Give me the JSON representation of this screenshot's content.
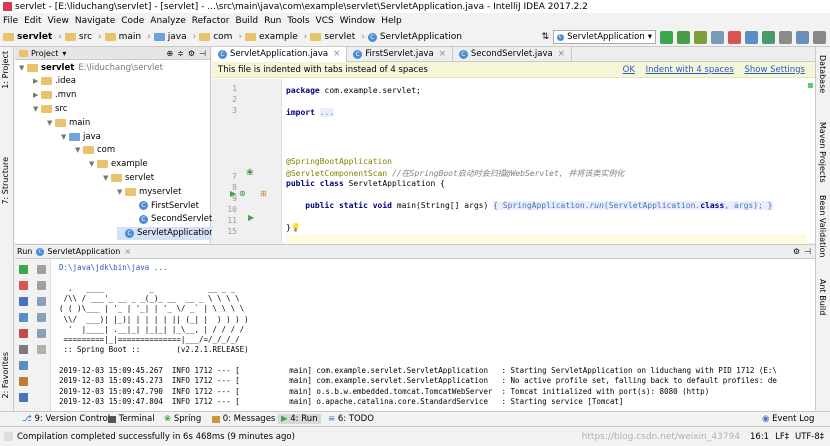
{
  "window": {
    "title": "servlet - [E:\\liduchang\\servlet] - [servlet] - ...\\src\\main\\java\\com\\example\\servlet\\ServletApplication.java - IntelliJ IDEA 2017.2.2"
  },
  "menu": [
    "File",
    "Edit",
    "View",
    "Navigate",
    "Code",
    "Analyze",
    "Refactor",
    "Build",
    "Run",
    "Tools",
    "VCS",
    "Window",
    "Help"
  ],
  "breadcrumb": [
    "servlet",
    "src",
    "main",
    "java",
    "com",
    "example",
    "servlet",
    "ServletApplication"
  ],
  "run_config": "ServletApplication",
  "left_tabs": {
    "project": "1: Project",
    "structure": "7: Structure",
    "favorites": "2: Favorites"
  },
  "right_tabs": {
    "database": "Database",
    "maven": "Maven Projects",
    "bean": "Bean Validation",
    "ant": "Ant Build"
  },
  "project": {
    "header": "Project",
    "tree": [
      {
        "label": "servlet",
        "extra": "E:\\liduchang\\servlet",
        "kind": "folder",
        "depth": 0,
        "open": true
      },
      {
        "label": ".idea",
        "kind": "folder",
        "depth": 1,
        "open": false
      },
      {
        "label": ".mvn",
        "kind": "folder",
        "depth": 1,
        "open": false
      },
      {
        "label": "src",
        "kind": "folder",
        "depth": 1,
        "open": true
      },
      {
        "label": "main",
        "kind": "folder",
        "depth": 2,
        "open": true
      },
      {
        "label": "java",
        "kind": "folder",
        "depth": 3,
        "open": true
      },
      {
        "label": "com",
        "kind": "folder",
        "depth": 4,
        "open": true
      },
      {
        "label": "example",
        "kind": "folder",
        "depth": 5,
        "open": true
      },
      {
        "label": "servlet",
        "kind": "folder",
        "depth": 6,
        "open": true
      },
      {
        "label": "myservlet",
        "kind": "folder",
        "depth": 7,
        "open": true
      },
      {
        "label": "FirstServlet",
        "kind": "class",
        "depth": 8
      },
      {
        "label": "SecondServlet",
        "kind": "class",
        "depth": 8
      },
      {
        "label": "ServletApplication",
        "kind": "class",
        "depth": 7,
        "selected": true
      }
    ]
  },
  "editor": {
    "tabs": [
      {
        "label": "ServletApplication.java",
        "active": true
      },
      {
        "label": "FirstServlet.java",
        "active": false
      },
      {
        "label": "SecondServlet.java",
        "active": false
      }
    ],
    "notice": "This file is indented with tabs instead of 4 spaces",
    "notice_actions": [
      "OK",
      "Indent with 4 spaces",
      "Show Settings"
    ],
    "line_numbers": [
      "1",
      "2",
      "3",
      "",
      "",
      "",
      "",
      "7",
      "8",
      "9",
      "10",
      "11",
      "",
      "",
      "15",
      "16"
    ],
    "lines": [
      {
        "n": "1",
        "text": "package com.example.servlet;"
      },
      {
        "n": "3",
        "text": "import ..."
      },
      {
        "n": "7",
        "text": "@SpringBootApplication"
      },
      {
        "n": "8",
        "text": "@ServletComponentScan //在SpringBoot启动时会扫描@WebServlet, 并将该类实例化"
      },
      {
        "n": "9",
        "text": "public class ServletApplication {"
      },
      {
        "n": "11",
        "text": "    public static void main(String[] args) { SpringApplication.run(ServletApplication.class, args); }"
      },
      {
        "n": "15",
        "text": "}"
      }
    ]
  },
  "run_panel": {
    "label": "Run",
    "config": "ServletApplication",
    "console": [
      "D:\\java\\jdk\\bin\\java ...",
      "",
      "  .   ____          _            __ _ _",
      " /\\\\ / ___'_ __ _ _(_)_ __  __ _ \\ \\ \\ \\",
      "( ( )\\___ | '_ | '_| | '_ \\/ _` | \\ \\ \\ \\",
      " \\\\/  ___)| |_)| | | | | || (_| |  ) ) ) )",
      "  '  |____| .__|_| |_|_| |_\\__, | / / / /",
      " =========|_|==============|___/=/_/_/_/",
      " :: Spring Boot ::        (v2.2.1.RELEASE)",
      "",
      "2019-12-03 15:09:45.267  INFO 1712 --- [           main] com.example.servlet.ServletApplication   : Starting ServletApplication on liduchang with PID 1712 (E:\\",
      "2019-12-03 15:09:45.273  INFO 1712 --- [           main] com.example.servlet.ServletApplication   : No active profile set, falling back to default profiles: de",
      "2019-12-03 15:09:47.790  INFO 1712 --- [           main] o.s.b.w.embedded.tomcat.TomcatWebServer  : Tomcat initialized with port(s): 8080 (http)",
      "2019-12-03 15:09:47.804  INFO 1712 --- [           main] o.apache.catalina.core.StandardService   : Starting service [Tomcat]"
    ]
  },
  "bottom_tabs": [
    {
      "label": "9: Version Control"
    },
    {
      "label": "Terminal"
    },
    {
      "label": "Spring"
    },
    {
      "label": "0: Messages"
    },
    {
      "label": "4: Run"
    },
    {
      "label": "6: TODO"
    },
    {
      "label": "Event Log"
    }
  ],
  "status": {
    "message": "Compilation completed successfully in 6s 468ms (9 minutes ago)",
    "position": "16:1",
    "line_sep": "LF‡",
    "encoding": "UTF-8‡"
  },
  "watermark": "https://blog.csdn.net/weixin_43794"
}
